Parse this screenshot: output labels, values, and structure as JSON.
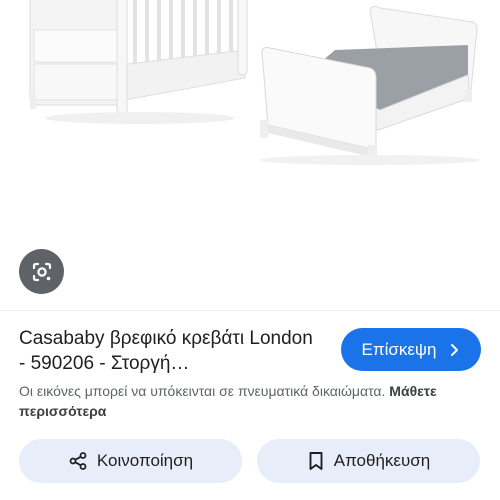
{
  "image": {
    "description_icon": "crib-and-toddler-bed-product-photo"
  },
  "lens": {
    "icon": "google-lens-icon"
  },
  "result": {
    "title": "Casababy βρεφικό κρεβάτι London - 590206 - Στοργή…",
    "visit_label": "Επίσκεψη",
    "notice_text": "Οι εικόνες μπορεί να υπόκεινται σε πνευματικά δικαιώματα.",
    "learn_more": "Μάθετε περισσότερα"
  },
  "actions": {
    "share_label": "Κοινοποίηση",
    "save_label": "Αποθήκευση"
  },
  "colors": {
    "accent": "#1a73e8",
    "action_bg": "#e8eef9",
    "lens_bg": "#5f6368"
  }
}
